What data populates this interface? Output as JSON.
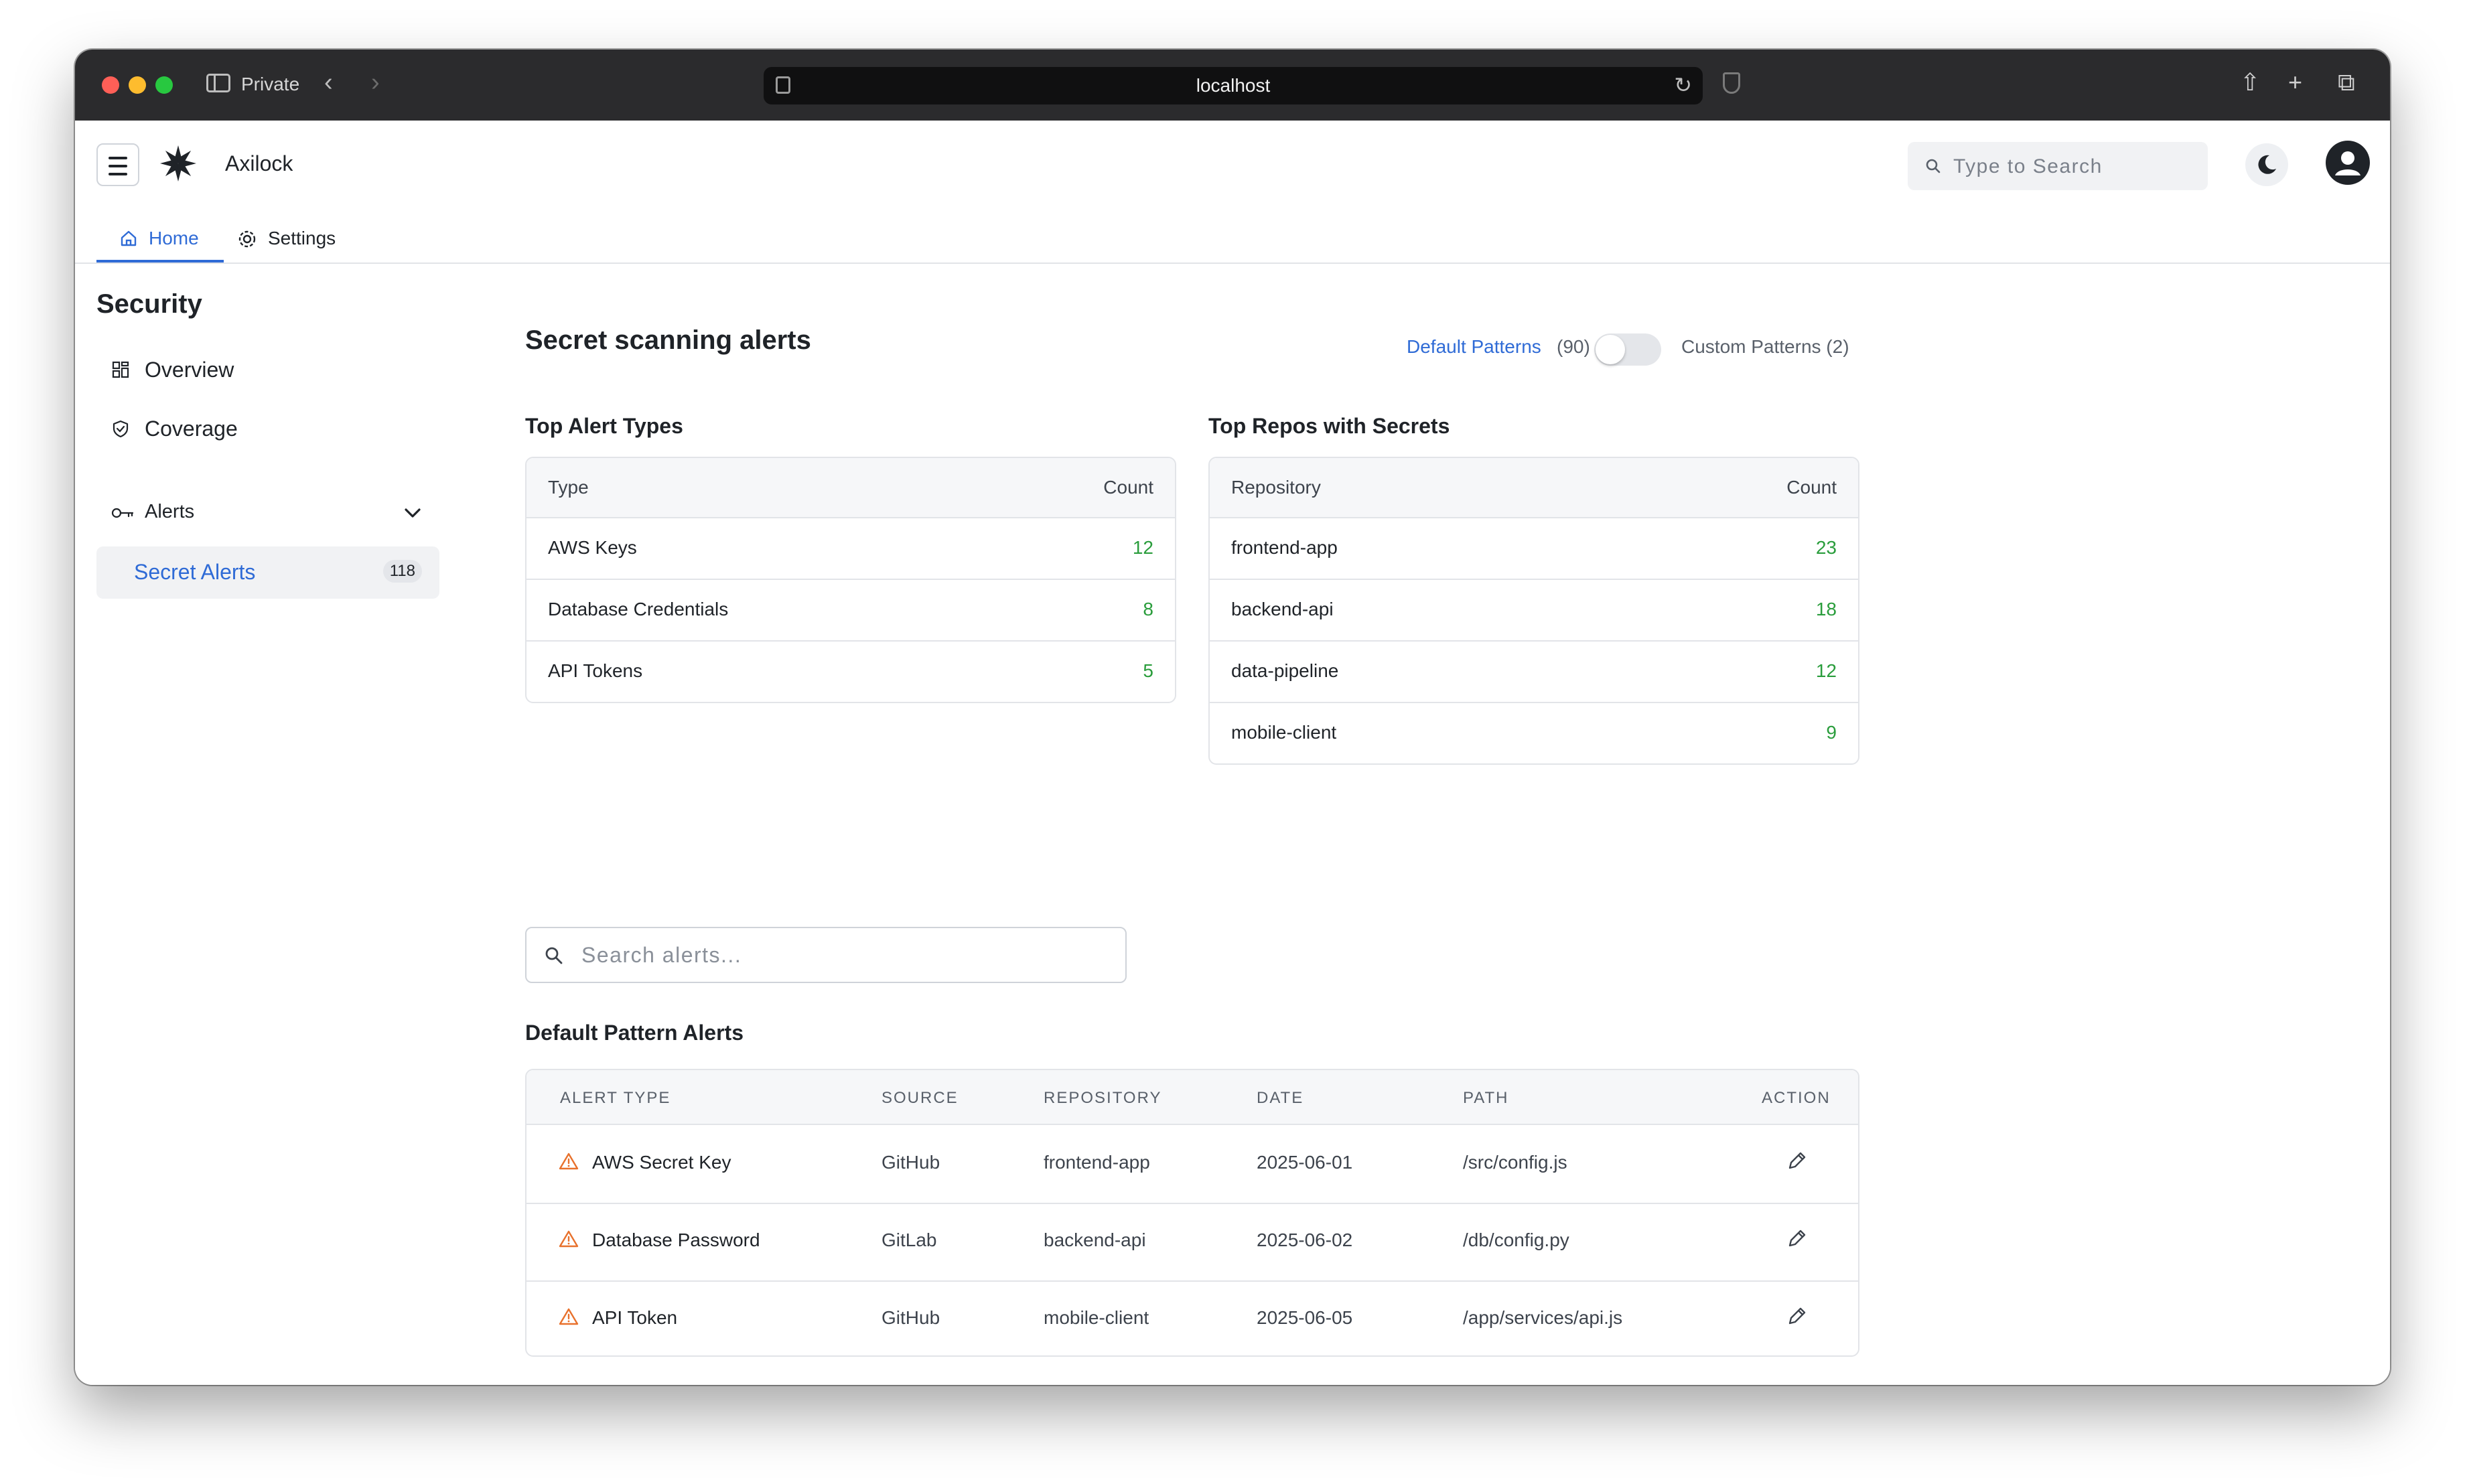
{
  "browser": {
    "private_label": "Private",
    "url": "localhost"
  },
  "app": {
    "name": "Axilock",
    "search_placeholder": "Type to Search",
    "tabs": [
      {
        "label": "Home",
        "active": true
      },
      {
        "label": "Settings",
        "active": false
      }
    ]
  },
  "sidebar": {
    "title": "Security",
    "items": [
      {
        "label": "Overview"
      },
      {
        "label": "Coverage"
      },
      {
        "label": "Alerts"
      },
      {
        "label": "Secret Alerts",
        "badge": "118",
        "active": true
      }
    ]
  },
  "main": {
    "title": "Secret scanning alerts",
    "patterns": {
      "default_label": "Default Patterns",
      "default_count": "(90)",
      "custom_label": "Custom Patterns (2)",
      "custom_enabled": false
    },
    "top_alert_types": {
      "title": "Top Alert Types",
      "headers": [
        "Type",
        "Count"
      ],
      "rows": [
        {
          "name": "AWS Keys",
          "count": "12"
        },
        {
          "name": "Database Credentials",
          "count": "8"
        },
        {
          "name": "API Tokens",
          "count": "5"
        }
      ]
    },
    "top_repos": {
      "title": "Top Repos with Secrets",
      "headers": [
        "Repository",
        "Count"
      ],
      "rows": [
        {
          "name": "frontend-app",
          "count": "23"
        },
        {
          "name": "backend-api",
          "count": "18"
        },
        {
          "name": "data-pipeline",
          "count": "12"
        },
        {
          "name": "mobile-client",
          "count": "9"
        }
      ]
    },
    "search_placeholder": "Search alerts...",
    "alerts": {
      "title": "Default Pattern Alerts",
      "headers": [
        "ALERT TYPE",
        "SOURCE",
        "REPOSITORY",
        "DATE",
        "PATH",
        "ACTION"
      ],
      "rows": [
        {
          "type": "AWS Secret Key",
          "source": "GitHub",
          "repo": "frontend-app",
          "date": "2025-06-01",
          "path": "/src/config.js"
        },
        {
          "type": "Database Password",
          "source": "GitLab",
          "repo": "backend-api",
          "date": "2025-06-02",
          "path": "/db/config.py"
        },
        {
          "type": "API Token",
          "source": "GitHub",
          "repo": "mobile-client",
          "date": "2025-06-05",
          "path": "/app/services/api.js"
        }
      ]
    }
  },
  "colors": {
    "accent": "#2f6bd6",
    "count_green": "#2a9d3c",
    "warning_orange": "#e8712c"
  }
}
